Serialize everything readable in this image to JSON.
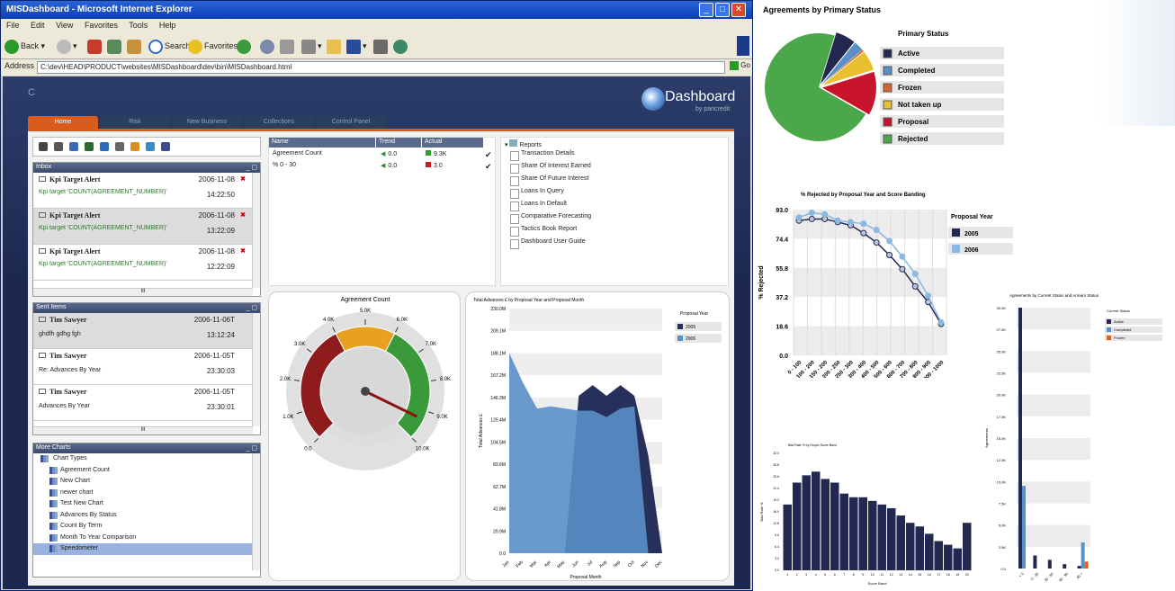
{
  "window": {
    "title": "MISDashboard - Microsoft Internet Explorer",
    "min": "_",
    "max": "□",
    "close": "✕"
  },
  "menu": [
    "File",
    "Edit",
    "View",
    "Favorites",
    "Tools",
    "Help"
  ],
  "toolbar": {
    "back": "Back",
    "search": "Search",
    "favorites": "Favorites"
  },
  "address": {
    "label": "Address",
    "value": "C:\\dev\\HEAD\\PRODUCT\\websites\\MISDashboard\\dev\\bin\\MISDashboard.html",
    "go": "Go"
  },
  "app": {
    "c_mark": "C",
    "logo": "Dashboard",
    "logo_sub": "by pancredit",
    "tabs": [
      "Home",
      "Risk",
      "New Business",
      "Collections",
      "Control Panel"
    ]
  },
  "icons_row": [
    "grid-icon",
    "mail-icon",
    "home-icon",
    "arrows-icon",
    "refresh-icon",
    "window-icon",
    "chart-icon",
    "globe-icon",
    "play-icon"
  ],
  "inbox": {
    "title": "Inbox",
    "ctl": "_ ▢",
    "items": [
      {
        "title": "Kpi Target Alert",
        "date": "2006-11-08",
        "time": "14:22:50",
        "text": "Kpi target 'COUNT(AGREEMENT_NUMBER)'"
      },
      {
        "title": "Kpi Target Alert",
        "date": "2006-11-08",
        "time": "13:22:09",
        "text": "Kpi target 'COUNT(AGREEMENT_NUMBER)'"
      },
      {
        "title": "Kpi Target Alert",
        "date": "2006-11-08",
        "time": "12:22:09",
        "text": "Kpi target 'COUNT(AGREEMENT_NUMBER)'"
      }
    ],
    "scroll_label": "III"
  },
  "sent": {
    "title": "Sent Items",
    "ctl": "_ ▢",
    "items": [
      {
        "title": "Tim Sawyer",
        "date": "2006-11-06T",
        "time": "13:12:24",
        "text": "ghdfh gdhg fgh"
      },
      {
        "title": "Tim Sawyer",
        "date": "2006-11-05T",
        "time": "23:30:03",
        "text": "Re: Advances By Year"
      },
      {
        "title": "Tim Sawyer",
        "date": "2006-11-05T",
        "time": "23:30:01",
        "text": "Advances By Year"
      }
    ],
    "scroll_label": "III"
  },
  "more_charts": {
    "title": "More Charts",
    "ctl": "_ ▢",
    "root": "Chart Types",
    "items": [
      "Agreement Count",
      "New Chart",
      "newer chart",
      "Test New Chart",
      "Advances By Status",
      "Count By Term",
      "Month To Year Comparison",
      "Speedometer"
    ]
  },
  "kpi": {
    "headers": [
      "Name",
      "Trend",
      "Actual"
    ],
    "rows": [
      {
        "name": "Agreement Count",
        "trend": "0.0",
        "actual": "9.3K",
        "status": "#2f9e2f"
      },
      {
        "name": "% 0 - 30",
        "trend": "0.0",
        "actual": "3.0",
        "status": "#c81e1e"
      }
    ]
  },
  "reports": {
    "root": "Reports",
    "items": [
      "Transaction Details",
      "Share Of Interest Earned",
      "Share Of Future Interest",
      "Loans In Query",
      "Loans In Default",
      "Comparative Forecasting",
      "Tactics Book Report",
      "Dashboard User Guide"
    ]
  },
  "gauge": {
    "title": "Agreement Count",
    "ticks": [
      "0.0",
      "1.0K",
      "2.0K",
      "3.0K",
      "4.0K",
      "5.0K",
      "6.0K",
      "7.0K",
      "8.0K",
      "9.0K",
      "10.0K"
    ],
    "value": 9.3,
    "max": 10,
    "bands": [
      {
        "from": 0,
        "to": 4,
        "color": "#8e1c1c"
      },
      {
        "from": 4,
        "to": 6,
        "color": "#e8a020"
      },
      {
        "from": 6,
        "to": 10,
        "color": "#3a9a3a"
      }
    ]
  },
  "area_chart": {
    "title": "Total Advances £ by Proposal Year and Proposal Month",
    "ylabel": "Total Advances £",
    "xlabel": "Proposal Month",
    "legend_title": "Proposal Year"
  },
  "chart_data": [
    {
      "type": "area",
      "title": "Total Advances £ by Proposal Year and Proposal Month",
      "xlabel": "Proposal Month",
      "ylabel": "Total Advances £",
      "categories": [
        "Jan",
        "Feb",
        "Mar",
        "Apr",
        "May",
        "Jun",
        "Jul",
        "Aug",
        "Sep",
        "Oct",
        "Nov",
        "Dec"
      ],
      "yticks": [
        "0.0",
        "20.9M",
        "41.8M",
        "62.7M",
        "83.6M",
        "104.5M",
        "125.4M",
        "146.3M",
        "167.2M",
        "188.1M",
        "209.1M",
        "230.0M"
      ],
      "ylim": [
        0,
        230
      ],
      "series": [
        {
          "name": "2005",
          "color": "#26305a",
          "values": [
            0,
            0,
            0,
            0,
            0,
            148,
            158,
            148,
            158,
            148,
            92,
            0
          ]
        },
        {
          "name": "2006",
          "color": "#5a8fc8",
          "values": [
            188,
            160,
            136,
            138,
            136,
            134,
            134,
            128,
            136,
            138,
            0,
            0
          ]
        }
      ]
    },
    {
      "type": "pie",
      "title": "Agreements by Primary Status",
      "legend_title": "Primary Status",
      "labels": [
        "Active",
        "Completed",
        "Frozen",
        "Not taken up",
        "Proposal",
        "Rejected"
      ],
      "colors": [
        "#222850",
        "#5a8fc8",
        "#d8642a",
        "#e8c030",
        "#c8142a",
        "#4aa84a"
      ],
      "values": [
        6,
        3,
        0.5,
        6,
        13,
        71.5
      ]
    },
    {
      "type": "line",
      "title": "% Rejected by Proposal Year and Score Banding",
      "xlabel": "Score Banding",
      "ylabel": "% Rejected",
      "legend_title": "Proposal Year",
      "categories": [
        "0 - 100",
        "100 - 200",
        "150 - 200",
        "200 - 250",
        "250 - 300",
        "300 - 400",
        "400 - 500",
        "500 - 600",
        "600 - 700",
        "700 - 800",
        "800 - 900",
        "900 - 1000"
      ],
      "yticks": [
        "0.0",
        "18.6",
        "37.2",
        "55.8",
        "74.4",
        "93.0"
      ],
      "ylim": [
        0,
        93
      ],
      "series": [
        {
          "name": "2005",
          "color": "#222850",
          "values": [
            86,
            87,
            87,
            85,
            83,
            78,
            72,
            64,
            55,
            44,
            34,
            20
          ]
        },
        {
          "name": "2006",
          "color": "#8ab8e0",
          "values": [
            88,
            91,
            90,
            86,
            85,
            84,
            80,
            73,
            63,
            52,
            38,
            21
          ]
        }
      ]
    },
    {
      "type": "bar",
      "title": "Bad Rate % by Dropin Score Band",
      "xlabel": "Score Band",
      "ylabel": "Bad Rate %",
      "categories": [
        "1",
        "2",
        "3",
        "4",
        "5",
        "6",
        "7",
        "8",
        "9",
        "10",
        "11",
        "12",
        "13",
        "14",
        "15",
        "16",
        "17",
        "18",
        "19",
        "20"
      ],
      "yticks": [
        "0.0",
        "3.2",
        "6.4",
        "9.6",
        "12.8",
        "16.0",
        "19.2",
        "22.4",
        "25.6",
        "28.8",
        "32.0"
      ],
      "ylim": [
        0,
        32
      ],
      "values": [
        18,
        24,
        26,
        27,
        25,
        24,
        21,
        20,
        20,
        19,
        18,
        17,
        15,
        13,
        12,
        10,
        8,
        7,
        6,
        13
      ]
    },
    {
      "type": "bar",
      "title": "Agreements by Current Status and Arrears Status",
      "ylabel": "Agreements",
      "legend_title": "Current Status",
      "categories": [
        "< 0",
        "0 - 30",
        "30 - 60",
        "60 - 90",
        "90 +"
      ],
      "yticks": [
        "0.0",
        "2.5K",
        "5.0K",
        "7.5K",
        "10.0K",
        "12.5K",
        "15.0K",
        "17.5K",
        "20.0K",
        "22.5K",
        "25.0K",
        "27.5K",
        "30.0K"
      ],
      "ylim": [
        0,
        30
      ],
      "series": [
        {
          "name": "Active",
          "color": "#222850",
          "values": [
            30,
            1.5,
            1.0,
            0.5,
            0.3
          ]
        },
        {
          "name": "Completed",
          "color": "#5a8fc8",
          "values": [
            9.5,
            0,
            0,
            0,
            3
          ]
        },
        {
          "name": "Frozen",
          "color": "#d8642a",
          "values": [
            0,
            0,
            0,
            0,
            0.8
          ]
        }
      ]
    }
  ]
}
